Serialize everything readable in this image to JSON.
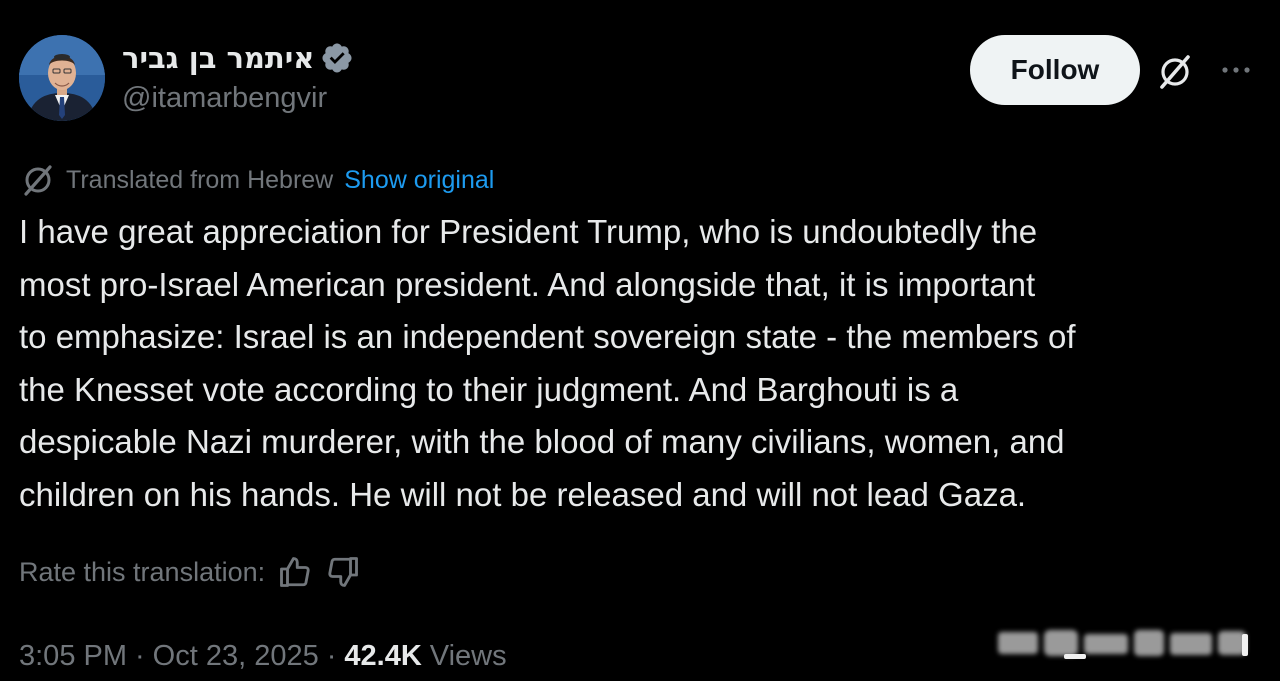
{
  "author": {
    "display_name": "איתמר בן גביר",
    "handle": "@itamarbengvir",
    "verified": true,
    "verified_color": "#71767b"
  },
  "header": {
    "follow_label": "Follow",
    "grok_icon": "grok-icon",
    "more_icon": "more-icon"
  },
  "translation": {
    "icon": "translate-icon",
    "translated_from": "Translated from Hebrew",
    "show_original": "Show original",
    "link_color": "#1d9bf0"
  },
  "tweet": {
    "lines": [
      "I have great appreciation for President Trump, who is undoubtedly the",
      "most pro-Israel American president. And alongside that, it is important",
      "to emphasize: Israel is an independent sovereign state - the members of",
      "the Knesset vote according to their judgment. And Barghouti is a",
      "despicable Nazi murderer, with the blood of many civilians, women, and",
      "children on his hands. He will not be released and will not lead Gaza."
    ]
  },
  "rating": {
    "label": "Rate this translation:",
    "thumbs_up_icon": "thumbs-up-icon",
    "thumbs_down_icon": "thumbs-down-icon"
  },
  "meta": {
    "time": "3:05 PM",
    "separator": "·",
    "date": "Oct 23, 2025",
    "views_count": "42.4K",
    "views_label": "Views"
  },
  "theme": {
    "background": "#000000",
    "text_primary": "#e7e9ea",
    "text_secondary": "#71767b",
    "button_bg": "#eff3f4"
  }
}
